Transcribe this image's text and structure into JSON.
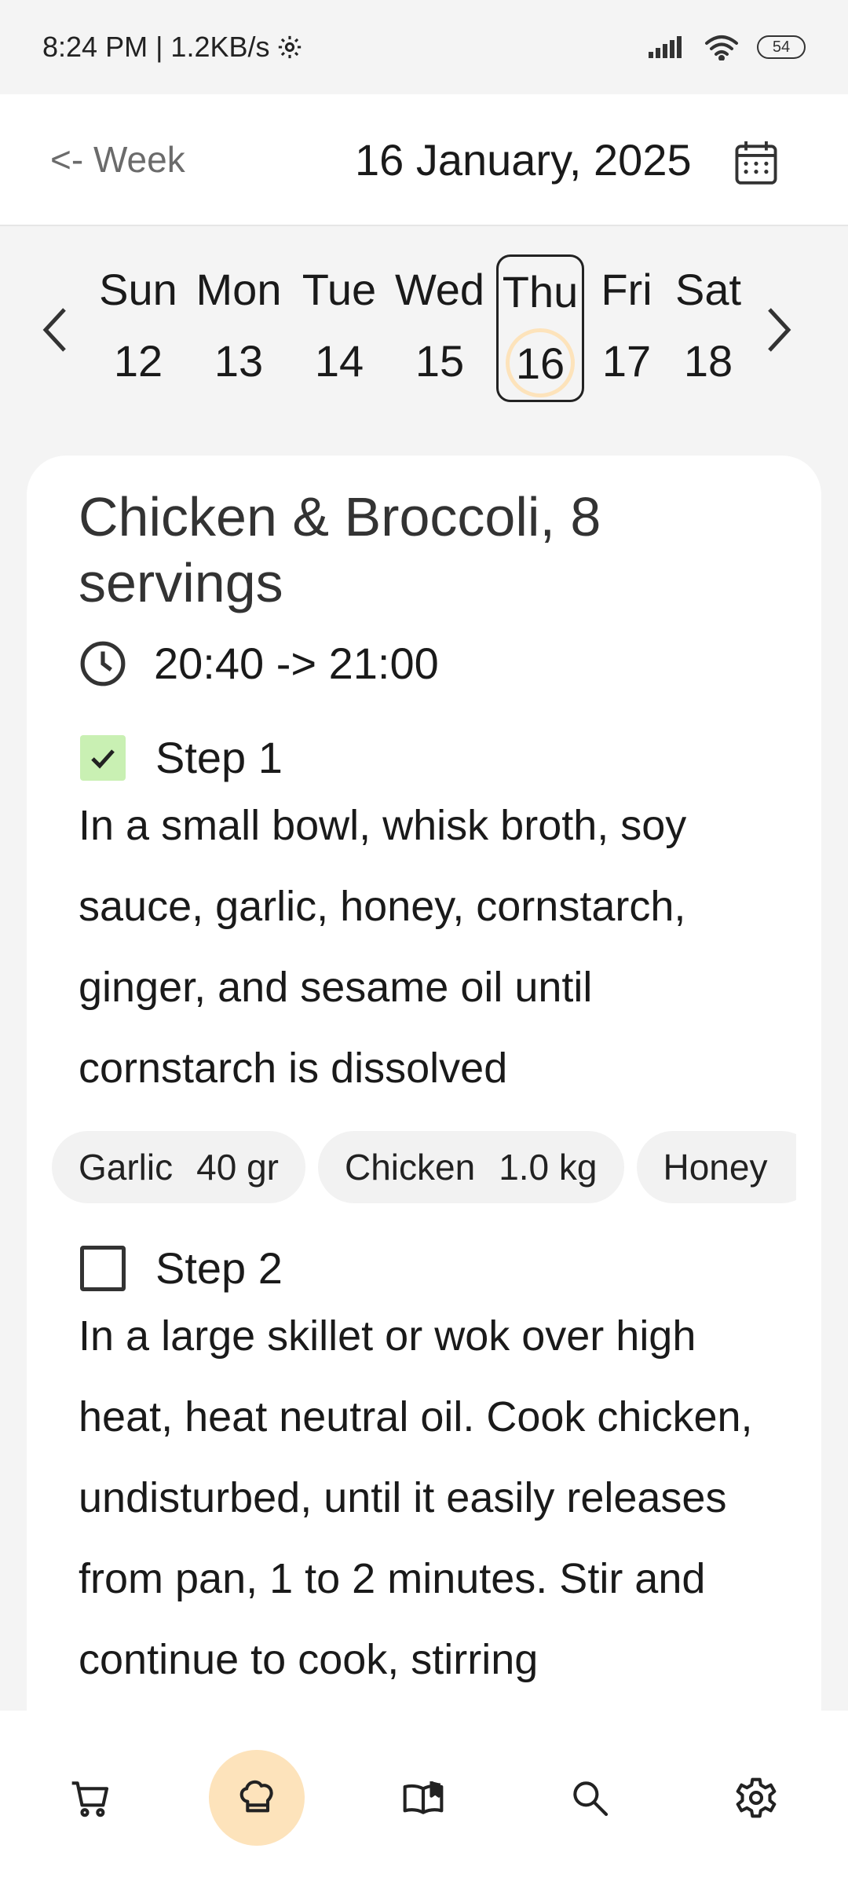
{
  "status_bar": {
    "time_speed": "8:24 PM | 1.2KB/s",
    "battery": "54",
    "icons": [
      "settings-gear-icon",
      "signal-icon",
      "wifi-icon",
      "battery-icon"
    ]
  },
  "header": {
    "back_label": "<- Week",
    "date": "16 January, 2025",
    "calendar_icon": "calendar-icon"
  },
  "week": {
    "days": [
      {
        "name": "Sun",
        "num": "12"
      },
      {
        "name": "Mon",
        "num": "13"
      },
      {
        "name": "Tue",
        "num": "14"
      },
      {
        "name": "Wed",
        "num": "15"
      },
      {
        "name": "Thu",
        "num": "16",
        "selected": true
      },
      {
        "name": "Fri",
        "num": "17"
      },
      {
        "name": "Sat",
        "num": "18"
      }
    ]
  },
  "recipe": {
    "title": "Chicken & Broccoli, 8 servings",
    "time": "20:40 -> 21:00",
    "steps": [
      {
        "label": "Step 1",
        "checked": true,
        "text": "In a small bowl, whisk broth, soy sauce, garlic, honey, cornstarch, ginger, and sesame oil until cornstarch is dissolved",
        "ingredients": [
          {
            "name": "Garlic",
            "qty": "40 gr"
          },
          {
            "name": "Chicken",
            "qty": "1.0 kg"
          },
          {
            "name": "Honey",
            "qty": ""
          }
        ]
      },
      {
        "label": "Step 2",
        "checked": false,
        "text": "In a large skillet or wok over high heat, heat neutral oil. Cook chicken, undisturbed, until it easily releases from pan, 1 to 2 minutes. Stir and continue to cook, stirring"
      }
    ]
  },
  "bottom_nav": {
    "items": [
      "cart-icon",
      "chef-hat-icon",
      "book-icon",
      "search-icon",
      "settings-icon"
    ],
    "active": "chef-hat-icon"
  },
  "colors": {
    "accent": "#fde3bb",
    "checked": "#c9f0b3",
    "background": "#f4f4f4",
    "card": "#ffffff"
  }
}
